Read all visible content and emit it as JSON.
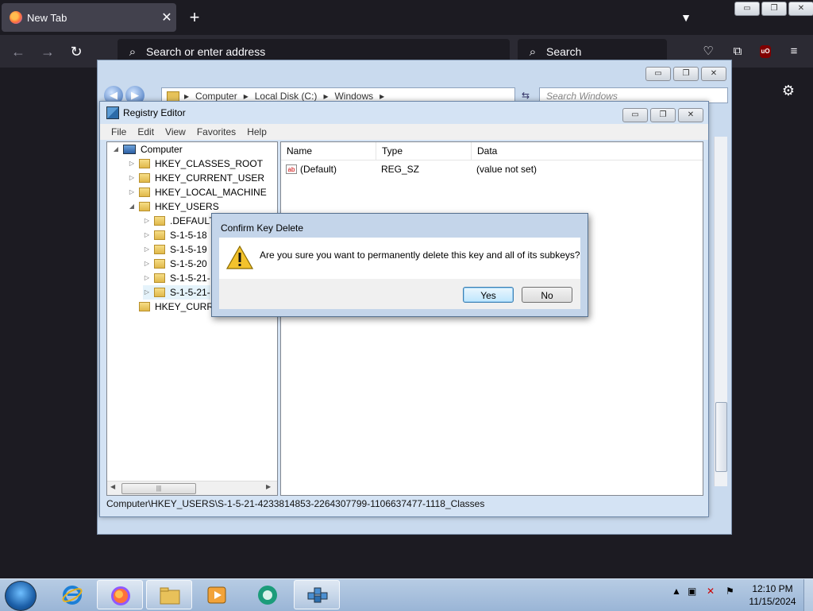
{
  "firefox": {
    "tab_title": "New Tab",
    "tab_close": "✕",
    "new_tab": "+",
    "address_placeholder": "Search or enter address",
    "search_placeholder": "Search",
    "addon_badge": "uO"
  },
  "window_controls": {
    "minimize": "▭",
    "restore": "❐",
    "close": "✕"
  },
  "explorer": {
    "breadcrumb": [
      "Computer",
      "Local Disk (C:)",
      "Windows"
    ],
    "search_placeholder": "Search Windows"
  },
  "regedit": {
    "title": "Registry Editor",
    "menu": [
      "File",
      "Edit",
      "View",
      "Favorites",
      "Help"
    ],
    "tree": [
      {
        "label": "Computer",
        "expander": "◢"
      },
      {
        "label": "HKEY_CLASSES_ROOT",
        "expander": "▷"
      },
      {
        "label": "HKEY_CURRENT_USER",
        "expander": "▷"
      },
      {
        "label": "HKEY_LOCAL_MACHINE",
        "expander": "▷"
      },
      {
        "label": "HKEY_USERS",
        "expander": "◢"
      },
      {
        "label": ".DEFAULT",
        "expander": "▷"
      },
      {
        "label": "S-1-5-18",
        "expander": "▷"
      },
      {
        "label": "S-1-5-19",
        "expander": "▷"
      },
      {
        "label": "S-1-5-20",
        "expander": "▷"
      },
      {
        "label": "S-1-5-21-",
        "expander": "▷"
      },
      {
        "label": "S-1-5-21-",
        "expander": "▷"
      },
      {
        "label": "HKEY_CURRE",
        "expander": ""
      }
    ],
    "columns": [
      "Name",
      "Type",
      "Data"
    ],
    "values": [
      {
        "name": "(Default)",
        "type": "REG_SZ",
        "data": "(value not set)"
      }
    ],
    "status_path": "Computer\\HKEY_USERS\\S-1-5-21-4233814853-2264307799-1106637477-1118_Classes"
  },
  "dialog": {
    "title": "Confirm Key Delete",
    "message": "Are you sure you want to permanently delete this key and all of its subkeys?",
    "yes_label": "Yes",
    "no_label": "No"
  },
  "taskbar": {
    "time": "12:10 PM",
    "date": "11/15/2024",
    "apps": [
      "internet-explorer",
      "firefox",
      "file-explorer",
      "media-player",
      "app-green",
      "registry-editor"
    ]
  },
  "colors": {
    "firefox_bg": "#1c1b22",
    "firefox_toolbar": "#2b2a33",
    "aero_frame": "#d4e3f4",
    "default_button": "#3c7fb1"
  }
}
